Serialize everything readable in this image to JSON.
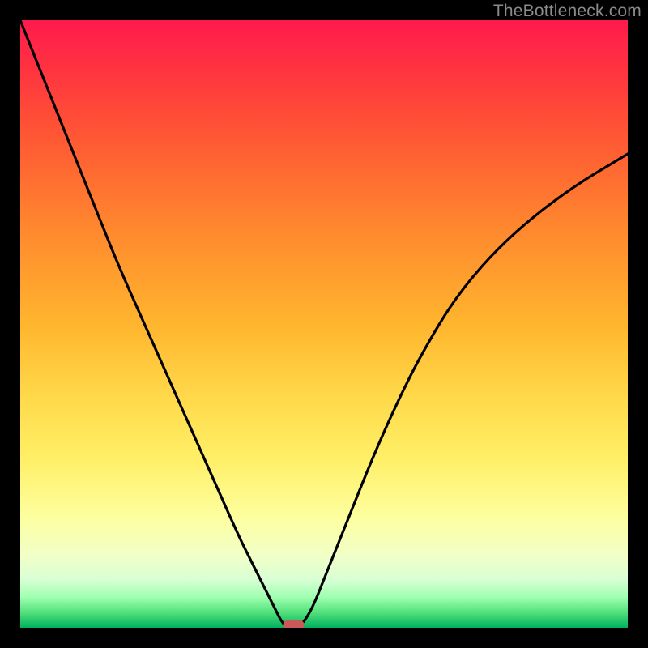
{
  "watermark": "TheBottleneck.com",
  "chart_data": {
    "type": "line",
    "title": "",
    "xlabel": "",
    "ylabel": "",
    "xlim": [
      0,
      100
    ],
    "ylim": [
      0,
      100
    ],
    "background_gradient": {
      "top": "#ff1a4d",
      "bottom": "#00b060",
      "meaning": "red = high bottleneck, green = low bottleneck"
    },
    "series": [
      {
        "name": "bottleneck-curve",
        "x": [
          0,
          4,
          8,
          12,
          16,
          20,
          24,
          28,
          32,
          36,
          38,
          40,
          42,
          43,
          44,
          46,
          48,
          50,
          54,
          58,
          62,
          66,
          72,
          80,
          90,
          100
        ],
        "y": [
          100,
          90,
          80,
          70,
          60,
          51,
          42,
          33,
          24,
          15,
          11,
          7,
          3,
          1,
          0,
          0,
          3,
          8,
          18,
          28,
          37,
          45,
          55,
          64,
          72,
          78
        ]
      }
    ],
    "marker": {
      "x": 45,
      "y": 0,
      "color": "#c85a5a",
      "shape": "rounded-rect"
    }
  }
}
